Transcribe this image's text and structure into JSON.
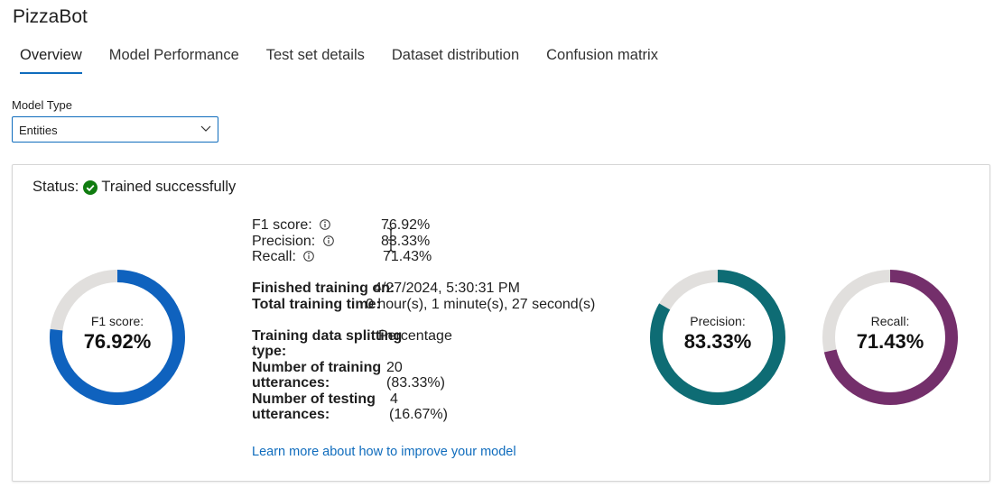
{
  "app": {
    "title": "PizzaBot"
  },
  "tabs": [
    {
      "label": "Overview",
      "active": true
    },
    {
      "label": "Model Performance"
    },
    {
      "label": "Test set details"
    },
    {
      "label": "Dataset distribution"
    },
    {
      "label": "Confusion matrix"
    }
  ],
  "model_type": {
    "label": "Model Type",
    "selected": "Entities"
  },
  "status": {
    "prefix": "Status:",
    "text": "Trained successfully",
    "icon": "check-circle-icon",
    "color": "#107c10"
  },
  "metrics": {
    "f1_label": "F1 score:",
    "f1_value": "76.92%",
    "precision_label": "Precision:",
    "precision_value": "83.33%",
    "recall_label": "Recall:",
    "recall_value": "71.43%"
  },
  "training": {
    "finished_label": "Finished training on:",
    "finished_value": "4/27/2024, 5:30:31 PM",
    "total_label": "Total training time:",
    "total_value": "0 hour(s), 1 minute(s), 27 second(s)",
    "split_label_1": "Training data splitting",
    "split_label_2": "type:",
    "split_value": "Percentage",
    "train_label_1": "Number of training",
    "train_label_2": "utterances:",
    "train_value": "20",
    "train_pct": "(83.33%)",
    "test_label_1": "Number of testing",
    "test_label_2": "utterances:",
    "test_value": "4",
    "test_pct": "(16.67%)"
  },
  "link": {
    "text": "Learn more about how to improve your model"
  },
  "donuts": [
    {
      "label": "F1 score:",
      "value": "76.92%",
      "fraction": 0.7692,
      "color": "#0f62be"
    },
    {
      "label": "Precision:",
      "value": "83.33%",
      "fraction": 0.8333,
      "color": "#0e6c74"
    },
    {
      "label": "Recall:",
      "value": "71.43%",
      "fraction": 0.7143,
      "color": "#742f6b"
    }
  ],
  "colors": {
    "accent": "#0f6cbd",
    "track": "#e1dfdd"
  }
}
